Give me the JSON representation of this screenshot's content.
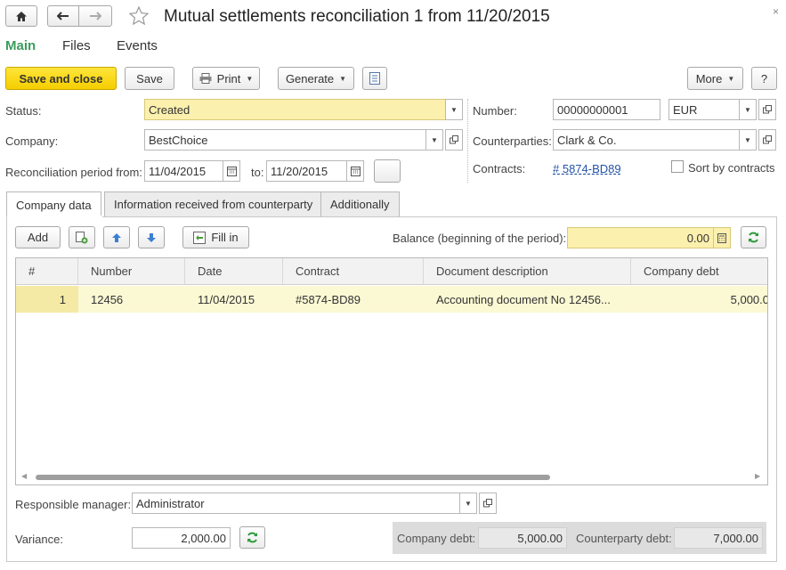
{
  "title": "Mutual settlements reconciliation 1 from 11/20/2015",
  "main_tabs": [
    "Main",
    "Files",
    "Events"
  ],
  "toolbar": {
    "save_close": "Save and close",
    "save": "Save",
    "print": "Print",
    "generate": "Generate",
    "more": "More",
    "help": "?"
  },
  "fields": {
    "status_label": "Status:",
    "status_value": "Created",
    "company_label": "Company:",
    "company_value": "BestChoice",
    "period_label": "Reconciliation period from:",
    "period_from": "11/04/2015",
    "to_label": "to:",
    "period_to": "11/20/2015",
    "number_label": "Number:",
    "number_value": "00000000001",
    "currency_value": "EUR",
    "counterparties_label": "Counterparties:",
    "counterparties_value": "Clark & Co.",
    "contracts_label": "Contracts:",
    "contracts_value": "# 5874-BD89",
    "sort_by_contracts": "Sort by contracts"
  },
  "tabs": [
    "Company data",
    "Information received from counterparty",
    "Additionally"
  ],
  "grid_toolbar": {
    "add": "Add",
    "fill_in": "Fill in",
    "balance_label": "Balance (beginning of the period):",
    "balance_value": "0.00"
  },
  "table": {
    "columns": [
      "#",
      "Number",
      "Date",
      "Contract",
      "Document description",
      "Company debt"
    ],
    "rows": [
      [
        "1",
        "12456",
        "11/04/2015",
        "#5874-BD89",
        "Accounting document No 12456...",
        "5,000.0"
      ]
    ]
  },
  "footer": {
    "manager_label": "Responsible manager:",
    "manager_value": "Administrator",
    "variance_label": "Variance:",
    "variance_value": "2,000.00",
    "company_debt_label": "Company debt:",
    "company_debt_value": "5,000.00",
    "counterparty_debt_label": "Counterparty debt:",
    "counterparty_debt_value": "7,000.00"
  }
}
